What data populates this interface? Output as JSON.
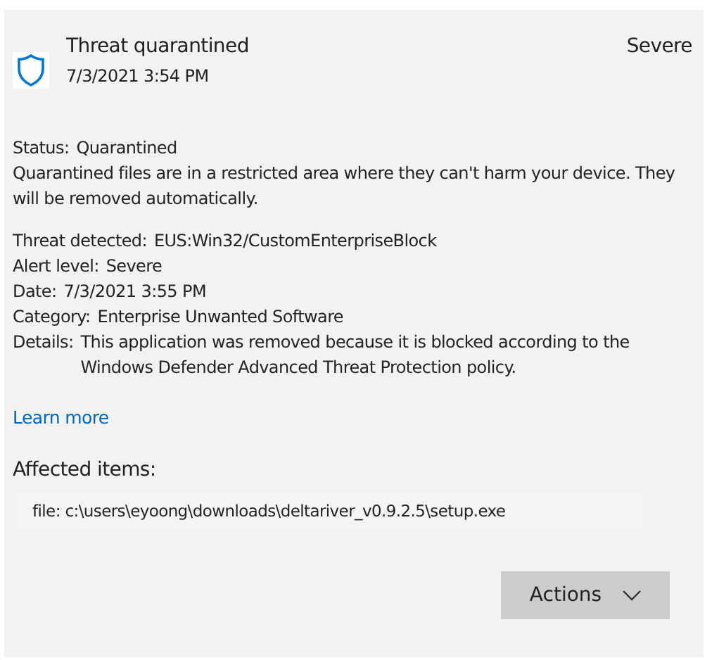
{
  "header": {
    "title": "Threat quarantined",
    "timestamp": "7/3/2021 3:54 PM",
    "severity": "Severe"
  },
  "status": {
    "label": "Status:",
    "value": "Quarantined",
    "description": "Quarantined files are in a restricted area where they can't harm your device. They will be removed automatically."
  },
  "details": [
    {
      "label": "Threat detected:",
      "value": "EUS:Win32/CustomEnterpriseBlock"
    },
    {
      "label": "Alert level:",
      "value": "Severe"
    },
    {
      "label": "Date:",
      "value": "7/3/2021 3:55 PM"
    },
    {
      "label": "Category:",
      "value": "Enterprise Unwanted Software"
    },
    {
      "label": "Details:",
      "value": "This application was removed because it is blocked according to the Windows Defender Advanced Threat Protection policy."
    }
  ],
  "learn_more": "Learn more",
  "affected_items": {
    "heading": "Affected items:",
    "items": [
      "file: c:\\users\\eyoong\\downloads\\deltariver_v0.9.2.5\\setup.exe"
    ]
  },
  "actions_button": "Actions"
}
